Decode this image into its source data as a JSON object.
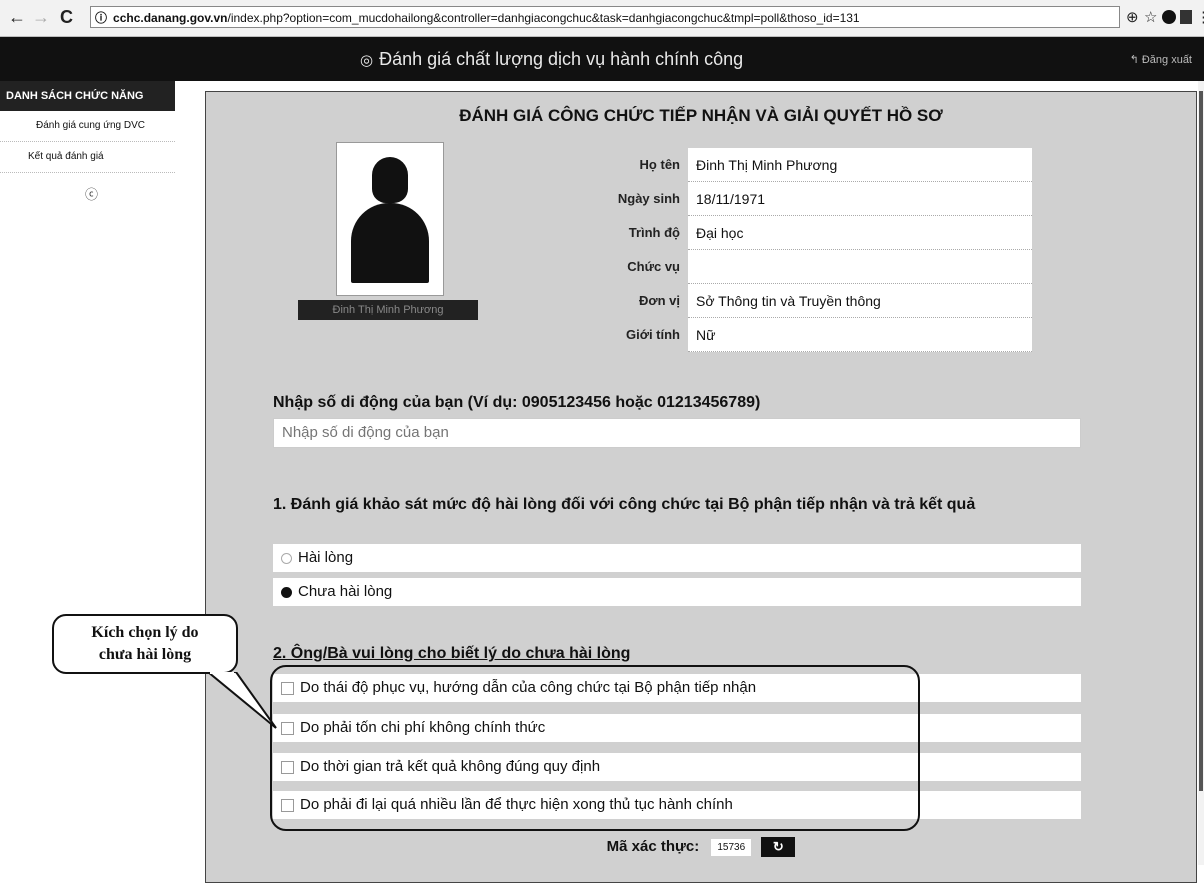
{
  "browser": {
    "back": "←",
    "forward": "→",
    "reload": "C",
    "info_icon": "ⓘ",
    "url_host": "cchc.danang.gov.vn",
    "url_path": "/index.php?option=com_mucdohailong&controller=danhgiacongchuc&task=danhgiacongchuc&tmpl=poll&thoso_id=131",
    "zoom_icon": "⊕",
    "star_icon": "☆",
    "menu_icon": "⋮"
  },
  "header": {
    "title": "Đánh giá chất lượng dịch vụ hành chính công",
    "logout": "Đăng xuất"
  },
  "sidebar": {
    "heading": "DANH SÁCH CHỨC NĂNG",
    "items": [
      {
        "label": "Đánh giá cung ứng DVC"
      },
      {
        "label": "Kết quả đánh giá"
      }
    ]
  },
  "panel": {
    "title": "ĐÁNH GIÁ CÔNG CHỨC TIẾP NHẬN VÀ GIẢI QUYẾT HỒ SƠ",
    "photo_caption": "Đinh Thị Minh Phương",
    "info": [
      {
        "label": "Họ tên",
        "value": "Đinh Thị Minh Phương"
      },
      {
        "label": "Ngày sinh",
        "value": "18/11/1971"
      },
      {
        "label": "Trình độ",
        "value": "Đại học"
      },
      {
        "label": "Chức vụ",
        "value": ""
      },
      {
        "label": "Đơn vị",
        "value": "Sở Thông tin và Truyền thông"
      },
      {
        "label": "Giới tính",
        "value": "Nữ"
      }
    ],
    "phone_label": "Nhập số di động của bạn (Ví dụ: 0905123456 hoặc 01213456789)",
    "phone_placeholder": "Nhập số di động của bạn",
    "q1_label": "1. Đánh giá khảo sát mức độ hài lòng đối với công chức tại Bộ phận tiếp nhận và trả kết quả",
    "q1_options": [
      {
        "label": "Hài lòng",
        "checked": false
      },
      {
        "label": "Chưa hài lòng",
        "checked": true
      }
    ],
    "q2_label": "2. Ông/Bà vui lòng cho biết lý do chưa hài lòng",
    "q2_options": [
      {
        "label": "Do thái độ phục vụ, hướng dẫn của công chức tại Bộ phận tiếp nhận"
      },
      {
        "label": "Do phải tốn chi phí không chính thức"
      },
      {
        "label": "Do thời gian trả kết quả không đúng quy định"
      },
      {
        "label": "Do phải đi lại quá nhiều lần để thực hiện xong thủ tục hành chính"
      }
    ],
    "captcha_label": "Mã xác thực:",
    "captcha_code": "15736",
    "refresh_icon": "↻"
  },
  "callout": {
    "line1": "Kích chọn lý do",
    "line2": "chưa hài lòng"
  }
}
